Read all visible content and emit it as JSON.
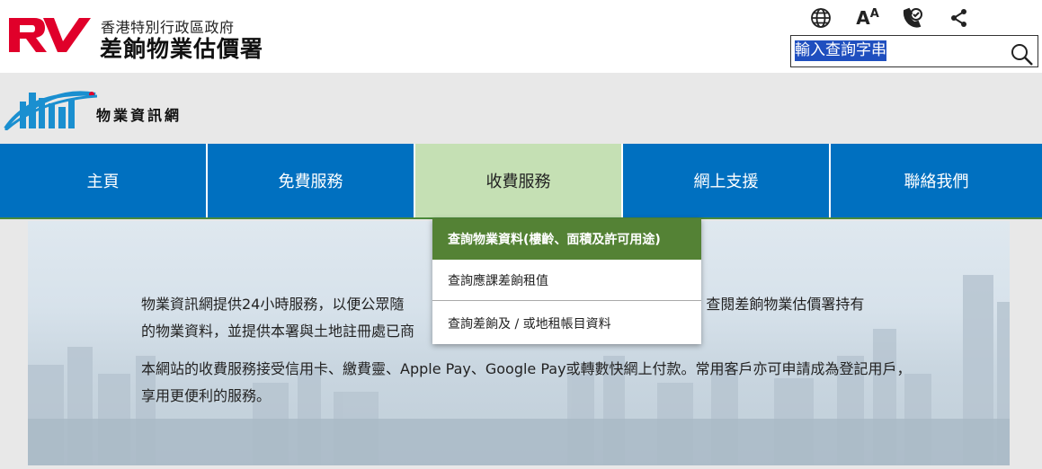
{
  "header": {
    "gov_name": "香港特別行政區政府",
    "dept_name": "差餉物業估價署",
    "tools": [
      "globe-icon",
      "font-size-icon",
      "contact-icon",
      "share-icon"
    ],
    "font_big": "A",
    "font_small": "A",
    "search": {
      "value": "輸入查詢字串"
    }
  },
  "site": {
    "title": "物業資訊網"
  },
  "nav": {
    "items": [
      {
        "label": "主頁"
      },
      {
        "label": "免費服務"
      },
      {
        "label": "收費服務"
      },
      {
        "label": "網上支援"
      },
      {
        "label": "聯絡我們"
      }
    ],
    "active_index": 2
  },
  "dropdown": {
    "items": [
      {
        "label": "查詢物業資料(樓齡、面積及許可用途)"
      },
      {
        "label": "查詢應課差餉租值"
      },
      {
        "label": "查詢差餉及 / 或地租帳目資料"
      }
    ]
  },
  "hero": {
    "p1_before": "物業資訊網提供24小時服務，以便公眾隨",
    "p1_after": "，查閱差餉物業估價署持有",
    "p1_line2": "的物業資料，並提供本署與土地註冊處已商",
    "p2": "本網站的收費服務接受信用卡、繳費靈、Apple Pay、Google Pay或轉數快網上付款。常用客戶亦可申請成為登記用戶，享用更便利的服務。"
  },
  "colors": {
    "nav_blue": "#0070c0",
    "nav_active": "#c5e0b4",
    "dropdown_active": "#548235",
    "logo_red": "#e0002a"
  }
}
